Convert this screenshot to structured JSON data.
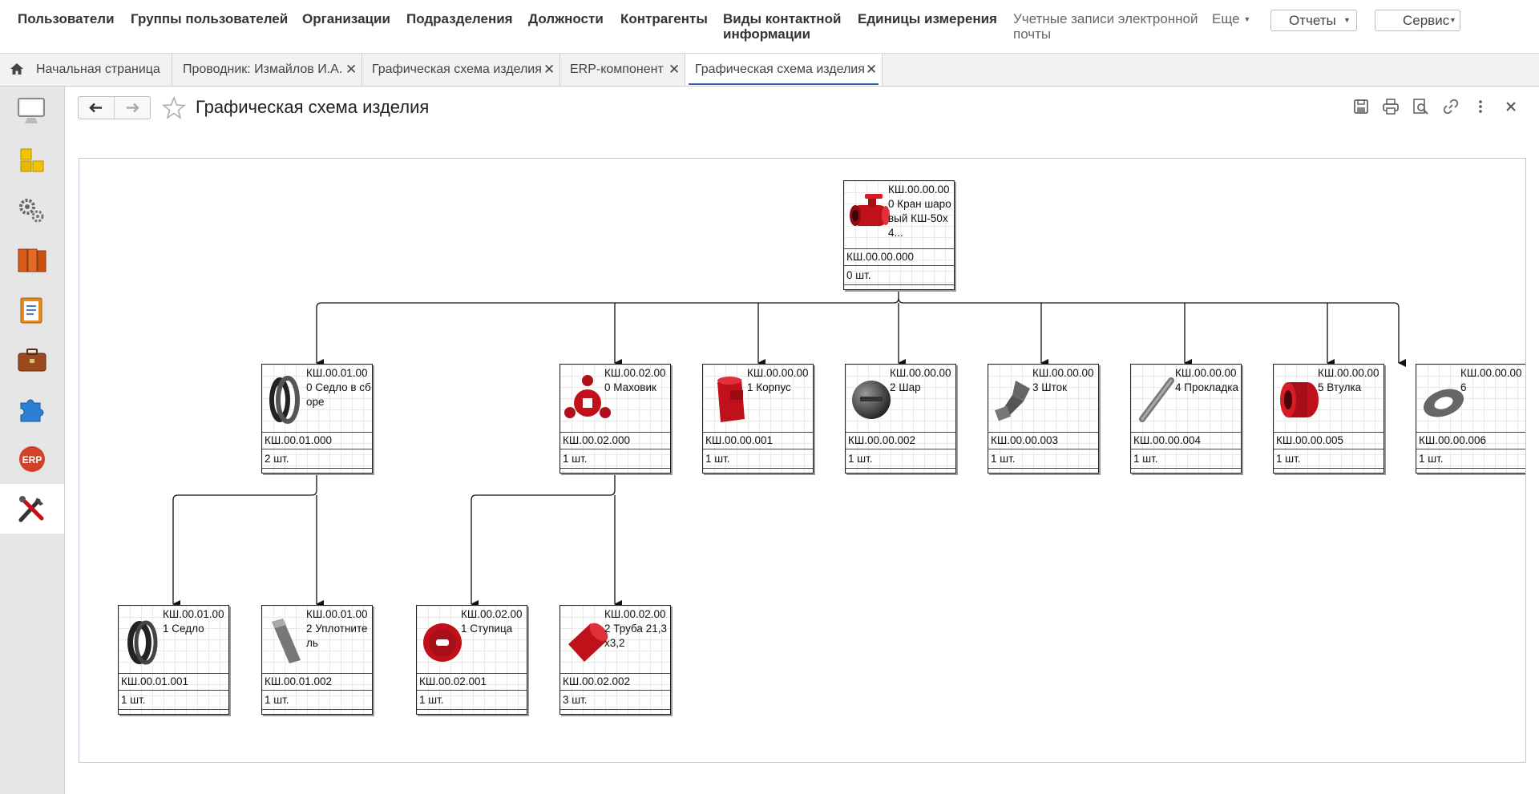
{
  "top_menu": {
    "users": "Пользователи",
    "user_groups": "Группы пользователей",
    "organizations": "Организации",
    "departments": "Подразделения",
    "positions": "Должности",
    "counterparties": "Контрагенты",
    "contact_info_line1": "Виды контактной",
    "contact_info_line2": "информации",
    "units": "Единицы измерения",
    "email_accounts_line1": "Учетные записи электронной",
    "email_accounts_line2": "почты",
    "more": "Еще",
    "reports": "Отчеты",
    "service": "Сервис"
  },
  "tabs": [
    {
      "label": "Начальная страница"
    },
    {
      "label": "Проводник: Измайлов И.А."
    },
    {
      "label": "Графическая схема изделия"
    },
    {
      "label": "ERP-компонент"
    },
    {
      "label": "Графическая схема изделия"
    }
  ],
  "sidebar": {
    "icons": [
      "monitor-icon",
      "cubes-icon",
      "gears-icon",
      "binders-icon",
      "clipboard-icon",
      "briefcase-icon",
      "puzzle-icon",
      "erp-icon",
      "tools-icon"
    ],
    "erp_label": "ERP"
  },
  "header": {
    "title": "Графическая схема изделия"
  },
  "colors": {
    "accent": "#2e62b5",
    "part_red": "#c0111a",
    "part_gray": "#555555"
  },
  "nodes": [
    {
      "title": "КШ.00.00.000 Кран шаровый КШ-50х4...",
      "code": "КШ.00.00.000",
      "qty": "0 шт.",
      "icon": "valve-icon"
    },
    {
      "title": "КШ.00.01.000 Седло в сборе",
      "code": "КШ.00.01.000",
      "qty": "2 шт.",
      "icon": "seat-assembly-icon"
    },
    {
      "title": "КШ.00.02.000 Маховик",
      "code": "КШ.00.02.000",
      "qty": "1 шт.",
      "icon": "handwheel-icon"
    },
    {
      "title": "КШ.00.00.001 Корпус",
      "code": "КШ.00.00.001",
      "qty": "1 шт.",
      "icon": "body-icon"
    },
    {
      "title": "КШ.00.00.002 Шар",
      "code": "КШ.00.00.002",
      "qty": "1 шт.",
      "icon": "ball-icon"
    },
    {
      "title": "КШ.00.00.003 Шток",
      "code": "КШ.00.00.003",
      "qty": "1 шт.",
      "icon": "stem-icon"
    },
    {
      "title": "КШ.00.00.004 Прокладка",
      "code": "КШ.00.00.004",
      "qty": "1 шт.",
      "icon": "gasket-icon"
    },
    {
      "title": "КШ.00.00.005 Втулка",
      "code": "КШ.00.00.005",
      "qty": "1 шт.",
      "icon": "bushing-icon"
    },
    {
      "title": "КШ.00.00.006",
      "code": "КШ.00.00.006",
      "qty": "1 шт.",
      "icon": "washer-icon"
    },
    {
      "title": "КШ.00.01.001 Седло",
      "code": "КШ.00.01.001",
      "qty": "1 шт.",
      "icon": "seat-icon"
    },
    {
      "title": "КШ.00.01.002 Уплотнитель",
      "code": "КШ.00.01.002",
      "qty": "1 шт.",
      "icon": "seal-icon"
    },
    {
      "title": "КШ.00.02.001 Ступица",
      "code": "КШ.00.02.001",
      "qty": "1 шт.",
      "icon": "hub-icon"
    },
    {
      "title": "КШ.00.02.002 Труба 21,3х3,2",
      "code": "КШ.00.02.002",
      "qty": "3 шт.",
      "icon": "pipe-icon"
    }
  ]
}
